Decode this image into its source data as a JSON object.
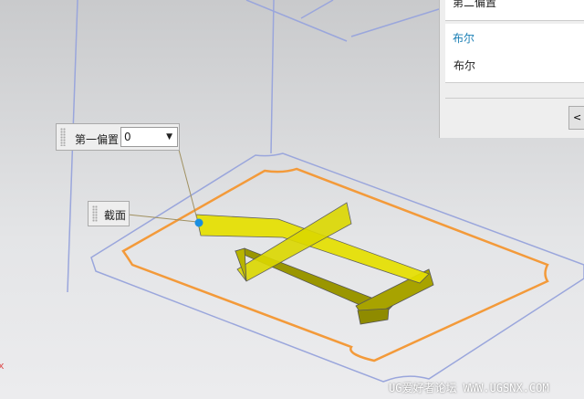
{
  "panel": {
    "top_label": "第二偏置",
    "section_title": "布尔",
    "boolean_label": "布尔",
    "ok_button": "< 确定"
  },
  "hud": {
    "offset_label": "第一偏置",
    "offset_value": "0",
    "section_label": "截面"
  },
  "watermark": "UG爱好者论坛 WWW.UGSNX.COM",
  "colors": {
    "accent": "#1a7fb5",
    "curve": "#f39a3a",
    "edge": "#9aa6dc",
    "solid": "#e6e000"
  }
}
